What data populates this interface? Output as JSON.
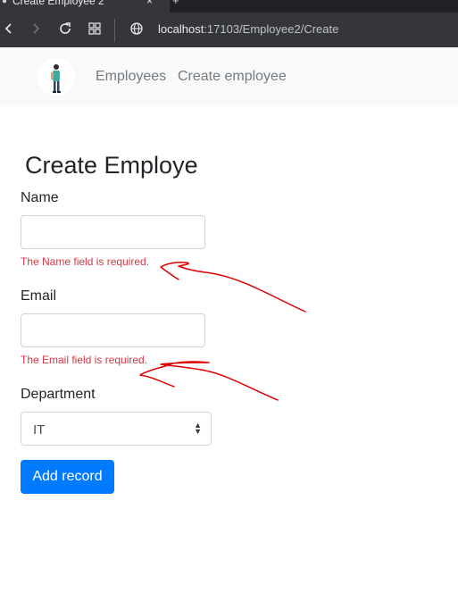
{
  "browser": {
    "tab_title": "Create Employee 2",
    "tab_close": "×",
    "new_tab": "+",
    "url_host": "localhost",
    "url_rest": ":17103/Employee2/Create"
  },
  "navbar": {
    "links": [
      "Employees",
      "Create employee"
    ]
  },
  "form": {
    "title": "Create Employe",
    "name_label": "Name",
    "name_value": "",
    "name_error": "The Name field is required.",
    "email_label": "Email",
    "email_value": "",
    "email_error": "The Email field is required.",
    "department_label": "Department",
    "department_selected": "IT",
    "submit_label": "Add record"
  },
  "colors": {
    "primary": "#007bff",
    "error": "#dc3545",
    "annotation": "#e00000"
  }
}
